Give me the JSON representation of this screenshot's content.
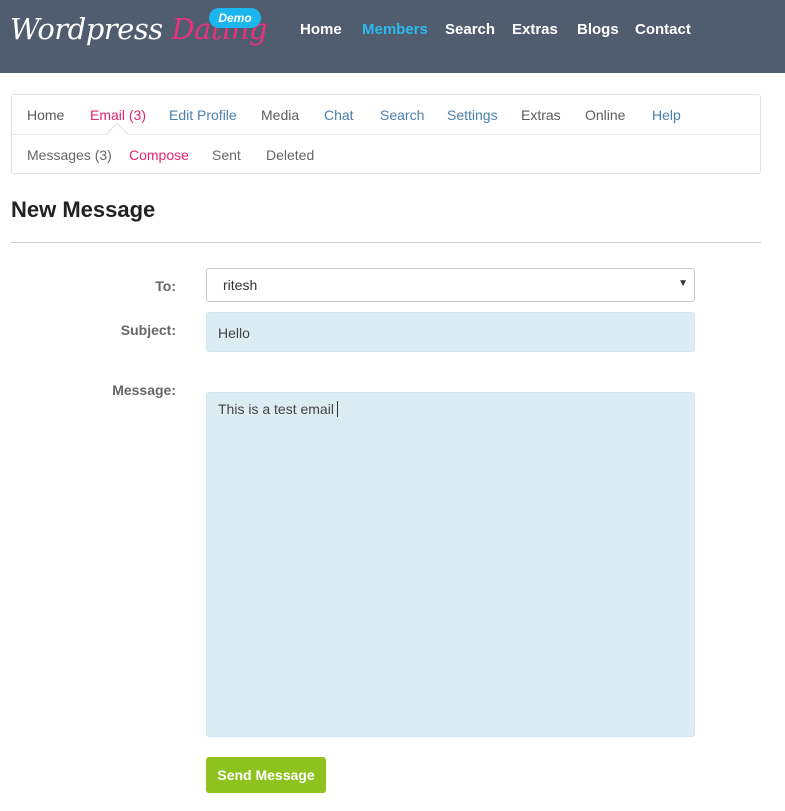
{
  "header": {
    "logo": {
      "part1": "Wordpress",
      "part2": "Dating"
    },
    "badge": "Demo",
    "nav": [
      {
        "label": "Home",
        "active": false
      },
      {
        "label": "Members",
        "active": true
      },
      {
        "label": "Search",
        "active": false
      },
      {
        "label": "Extras",
        "active": false
      },
      {
        "label": "Blogs",
        "active": false
      },
      {
        "label": "Contact",
        "active": false
      }
    ]
  },
  "member_nav": [
    {
      "label": "Home"
    },
    {
      "label": "Email (3)",
      "active": true
    },
    {
      "label": "Edit Profile"
    },
    {
      "label": "Media"
    },
    {
      "label": "Chat"
    },
    {
      "label": "Search"
    },
    {
      "label": "Settings"
    },
    {
      "label": "Extras"
    },
    {
      "label": "Online"
    },
    {
      "label": "Help"
    }
  ],
  "email_nav": [
    {
      "label": "Messages (3)"
    },
    {
      "label": "Compose",
      "active": true
    },
    {
      "label": "Sent"
    },
    {
      "label": "Deleted"
    }
  ],
  "page": {
    "title": "New Message"
  },
  "form": {
    "to_label": "To:",
    "to_value": "ritesh",
    "subject_label": "Subject:",
    "subject_value": "Hello",
    "message_label": "Message:",
    "message_value": "This is a test email",
    "send_label": "Send Message"
  },
  "colors": {
    "header_bg": "#4f5d6f",
    "accent_blue": "#2cb9ef",
    "accent_pink": "#e3266c",
    "link_blue": "#4a7fab",
    "field_bg": "#dbecf2",
    "button_green": "#8dc21f"
  }
}
